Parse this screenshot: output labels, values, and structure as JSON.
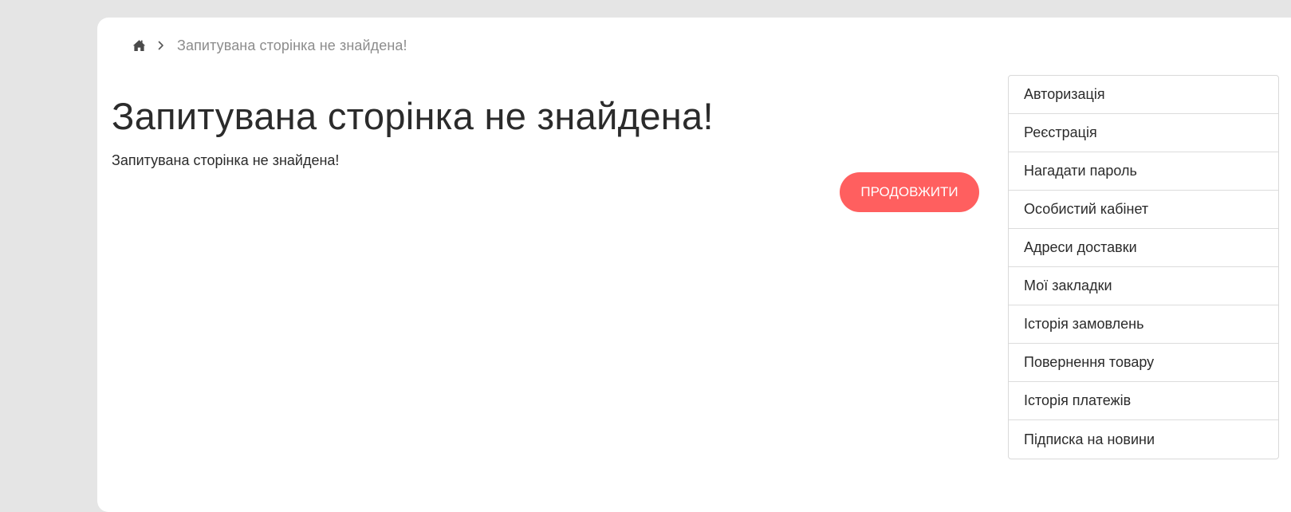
{
  "breadcrumb": {
    "home_icon": "home-icon",
    "separator_icon": "chevron-right-icon",
    "current": "Запитувана сторінка не знайдена!"
  },
  "main": {
    "title": "Запитувана сторінка не знайдена!",
    "text": "Запитувана сторінка не знайдена!",
    "continue_label": "Продовжити"
  },
  "sidebar": {
    "items": [
      {
        "label": "Авторизація"
      },
      {
        "label": "Реєстрація"
      },
      {
        "label": "Нагадати пароль"
      },
      {
        "label": "Особистий кабінет"
      },
      {
        "label": "Адреси доставки"
      },
      {
        "label": "Мої закладки"
      },
      {
        "label": "Історія замовлень"
      },
      {
        "label": "Повернення товару"
      },
      {
        "label": "Історія платежів"
      },
      {
        "label": "Підписка на новини"
      }
    ]
  },
  "colors": {
    "background": "#e5e5e5",
    "card": "#ffffff",
    "accent": "#ff5f5f",
    "text": "#2b2b2b",
    "muted_text": "#8c8c8c",
    "border": "#d9d9d9"
  }
}
